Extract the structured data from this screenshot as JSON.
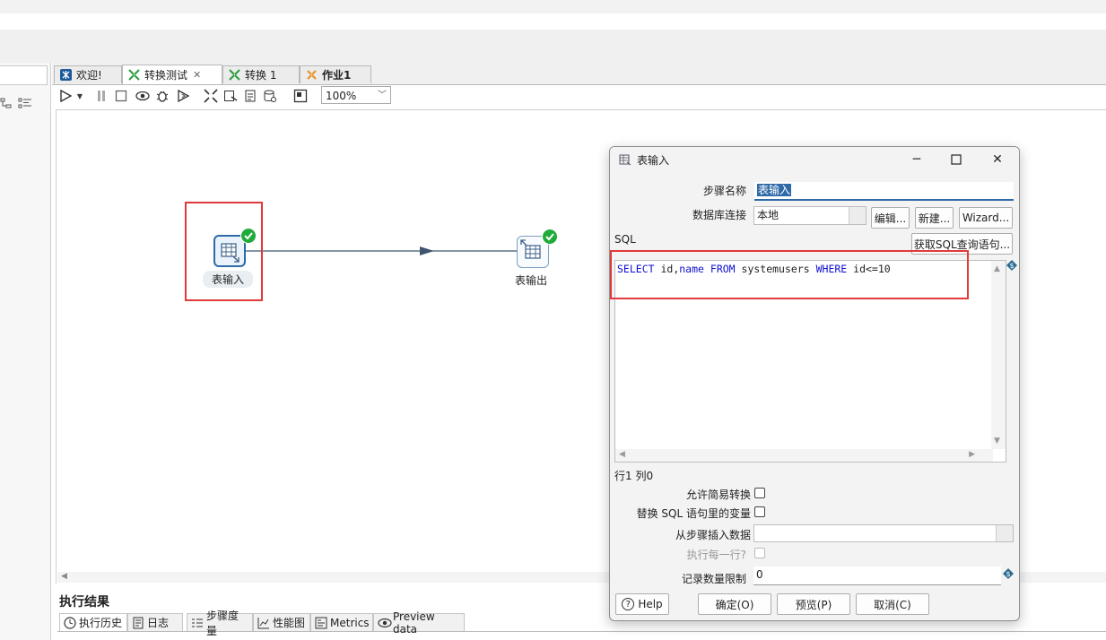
{
  "editor_tabs": [
    {
      "label": "欢迎!"
    },
    {
      "label": "转换测试"
    },
    {
      "label": "转换 1"
    },
    {
      "label": "作业1"
    }
  ],
  "toolbar": {
    "zoom": "100%"
  },
  "canvas": {
    "steps": [
      {
        "label": "表输入"
      },
      {
        "label": "表输出"
      }
    ]
  },
  "results": {
    "title": "执行结果",
    "tabs": [
      {
        "label": "执行历史"
      },
      {
        "label": "日志"
      },
      {
        "label": "步骤度量"
      },
      {
        "label": "性能图"
      },
      {
        "label": "Metrics"
      },
      {
        "label": "Preview data"
      }
    ]
  },
  "dialog": {
    "title": "表输入",
    "step_name_label": "步骤名称",
    "step_name_value": "表输入",
    "db_connection_label": "数据库连接",
    "db_connection_value": "本地",
    "edit_button": "编辑...",
    "new_button": "新建...",
    "wizard_button": "Wizard...",
    "sql_label": "SQL",
    "get_sql_button": "获取SQL查询语句...",
    "sql_tokens": [
      {
        "text": "SELECT",
        "kw": true
      },
      {
        "text": " id,",
        "kw": false
      },
      {
        "text": "name",
        "kw": true
      },
      {
        "text": " ",
        "kw": false
      },
      {
        "text": "FROM",
        "kw": true
      },
      {
        "text": " systemusers ",
        "kw": false
      },
      {
        "text": "WHERE",
        "kw": true
      },
      {
        "text": " id<=10",
        "kw": false
      }
    ],
    "cursor_position": "行1 列0",
    "lazy_conversion_label": "允许简易转换",
    "replace_vars_label": "替换 SQL 语句里的变量",
    "insert_from_step_label": "从步骤插入数据",
    "execute_each_row_label": "执行每一行?",
    "limit_label": "记录数量限制",
    "limit_value": "0",
    "help_button": "Help",
    "ok_button": "确定(O)",
    "preview_button": "预览(P)",
    "cancel_button": "取消(C)"
  },
  "colors": {
    "accent": "#2e6aa8",
    "highlight": "#e23a3a",
    "ok_badge": "#1faa3a",
    "sql_keyword": "#0f0fd0"
  }
}
